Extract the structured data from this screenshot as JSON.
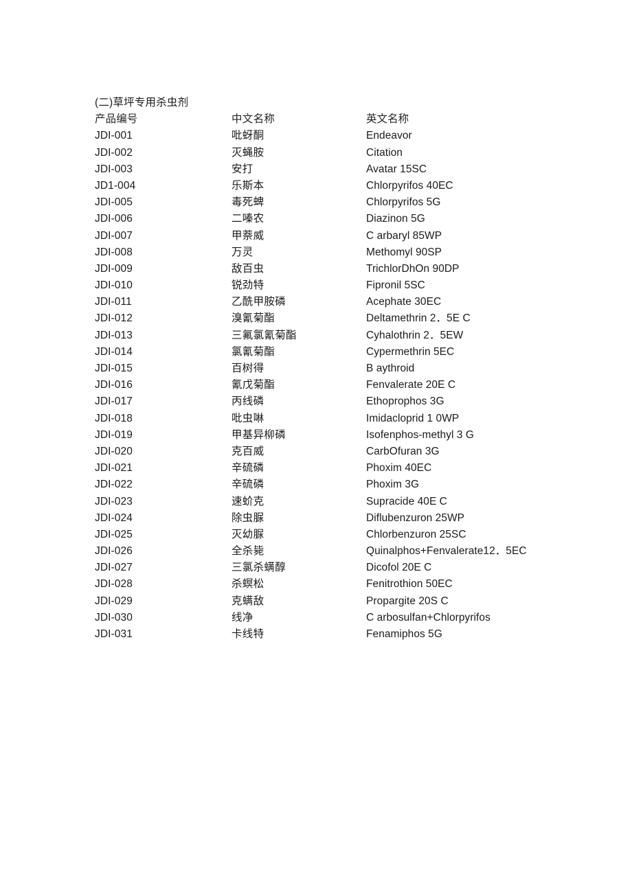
{
  "document": {
    "title": "(二)草坪专用杀虫剂",
    "background_color": "#ffffff",
    "text_color": "#1b1b1b"
  },
  "table": {
    "columns": [
      {
        "key": "code",
        "label": "产品编号"
      },
      {
        "key": "chinese_name",
        "label": "中文名称"
      },
      {
        "key": "english_name",
        "label": "英文名称"
      }
    ],
    "rows": [
      {
        "code": "JDI-001",
        "chinese_name": "吡蚜酮",
        "english_name": "Endeavor"
      },
      {
        "code": "JDI-002",
        "chinese_name": "灭蝇胺",
        "english_name": "Citation"
      },
      {
        "code": "JDI-003",
        "chinese_name": "安打",
        "english_name": "Avatar 15SC"
      },
      {
        "code": "JD1-004",
        "chinese_name": "乐斯本",
        "english_name": "Chlorpyrifos 40EC"
      },
      {
        "code": "JDI-005",
        "chinese_name": "毒死蜱",
        "english_name": "Chlorpyrifos 5G"
      },
      {
        "code": "JDI-006",
        "chinese_name": "二嗪农",
        "english_name": "Diazinon 5G"
      },
      {
        "code": "JDI-007",
        "chinese_name": "甲萘威",
        "english_name": "C arbaryl 85WP"
      },
      {
        "code": "JDI-008",
        "chinese_name": "万灵",
        "english_name": "Methomyl 90SP"
      },
      {
        "code": "JDI-009",
        "chinese_name": "敌百虫",
        "english_name": "TrichlorDhOn 90DP"
      },
      {
        "code": "JDI-010",
        "chinese_name": "锐劲特",
        "english_name": "Fipronil 5SC"
      },
      {
        "code": "JDI-011",
        "chinese_name": "乙酰甲胺磷",
        "english_name": "Acephate 30EC"
      },
      {
        "code": "JDI-012",
        "chinese_name": "溴氰菊酯",
        "english_name": "Deltamethrin 2．5E C"
      },
      {
        "code": "JDI-013",
        "chinese_name": "三氟氯氰菊酯",
        "english_name": "Cyhalothrin 2．5EW"
      },
      {
        "code": "JDI-014",
        "chinese_name": "氯氰菊酯",
        "english_name": "Cypermethrin 5EC"
      },
      {
        "code": "JDI-015",
        "chinese_name": "百树得",
        "english_name": "B aythroid"
      },
      {
        "code": "JDI-016",
        "chinese_name": "氰戊菊酯",
        "english_name": "Fenvalerate 20E C"
      },
      {
        "code": "JDI-017",
        "chinese_name": "丙线磷",
        "english_name": "Ethoprophos 3G"
      },
      {
        "code": "JDI-018",
        "chinese_name": "吡虫啉",
        "english_name": "Imidacloprid 1 0WP"
      },
      {
        "code": "JDI-019",
        "chinese_name": "甲基异柳磷",
        "english_name": "Isofenphos-methyl 3 G"
      },
      {
        "code": "JDI-020",
        "chinese_name": "克百威",
        "english_name": "CarbOfuran 3G"
      },
      {
        "code": "JDI-021",
        "chinese_name": "辛硫磷",
        "english_name": "Phoxim 40EC"
      },
      {
        "code": "JDI-022",
        "chinese_name": "辛硫磷",
        "english_name": "Phoxim 3G"
      },
      {
        "code": "JDI-023",
        "chinese_name": "速蚧克",
        "english_name": "Supracide 40E C"
      },
      {
        "code": "JDI-024",
        "chinese_name": "除虫脲",
        "english_name": "Diflubenzuron 25WP"
      },
      {
        "code": "JDI-025",
        "chinese_name": "灭幼脲",
        "english_name": "Chlorbenzuron 25SC"
      },
      {
        "code": "JDI-026",
        "chinese_name": "全杀毙",
        "english_name": "Quinalphos+Fenvalerate12．5EC"
      },
      {
        "code": "JDI-027",
        "chinese_name": "三氯杀螨醇",
        "english_name": "Dicofol 20E C"
      },
      {
        "code": "JDI-028",
        "chinese_name": "杀螟松",
        "english_name": "Fenitrothion 50EC"
      },
      {
        "code": "JDI-029",
        "chinese_name": "克螨敌",
        "english_name": "Propargite 20S C"
      },
      {
        "code": "JDI-030",
        "chinese_name": "线净",
        "english_name": "C arbosulfan+Chlorpyrifos"
      },
      {
        "code": "JDI-031",
        "chinese_name": "卡线特",
        "english_name": "Fenamiphos 5G"
      }
    ]
  }
}
